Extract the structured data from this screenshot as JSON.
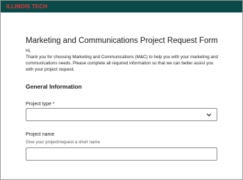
{
  "header": {
    "logo_text": "ILLINOIS TECH",
    "bar_color": "#0a4b49",
    "logo_color": "#e83838"
  },
  "form": {
    "title": "Marketing and Communications Project Request Form",
    "greeting": "Hi,",
    "intro": "Thank you for choosing Marketing and Communications (M&C) to help you with your marketing and communications needs. Please complete all required information so that we can better assist you with your project request.",
    "section_heading": "General Information",
    "project_type": {
      "label": "Project type *",
      "value": "",
      "icon": "chevron-down-icon"
    },
    "project_name": {
      "label": "Project name",
      "hint": "Give your project/request a short name",
      "value": ""
    }
  }
}
